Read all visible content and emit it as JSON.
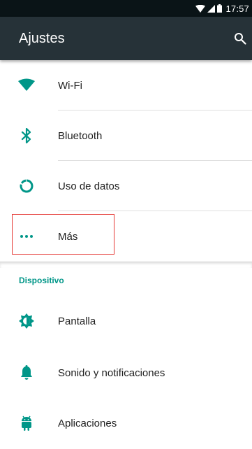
{
  "status_bar": {
    "time": "17:57",
    "icons": [
      "wifi-icon",
      "signal-icon",
      "battery-icon"
    ]
  },
  "app_bar": {
    "title": "Ajustes",
    "action_icon": "search-icon"
  },
  "colors": {
    "status_bar": "#0a1417",
    "app_bar": "#263238",
    "accent": "#009688",
    "highlight": "#e53935",
    "divider": "#e0e0e0",
    "text": "#212121"
  },
  "sections": [
    {
      "items": [
        {
          "label": "Wi-Fi",
          "icon": "wifi-icon"
        },
        {
          "label": "Bluetooth",
          "icon": "bluetooth-icon"
        },
        {
          "label": "Uso de datos",
          "icon": "data-usage-icon"
        },
        {
          "label": "Más",
          "icon": "more-horiz-icon"
        }
      ]
    },
    {
      "header": "Dispositivo",
      "items": [
        {
          "label": "Pantalla",
          "icon": "display-icon"
        },
        {
          "label": "Sonido y notificaciones",
          "icon": "bell-icon"
        },
        {
          "label": "Aplicaciones",
          "icon": "android-icon"
        }
      ]
    }
  ]
}
